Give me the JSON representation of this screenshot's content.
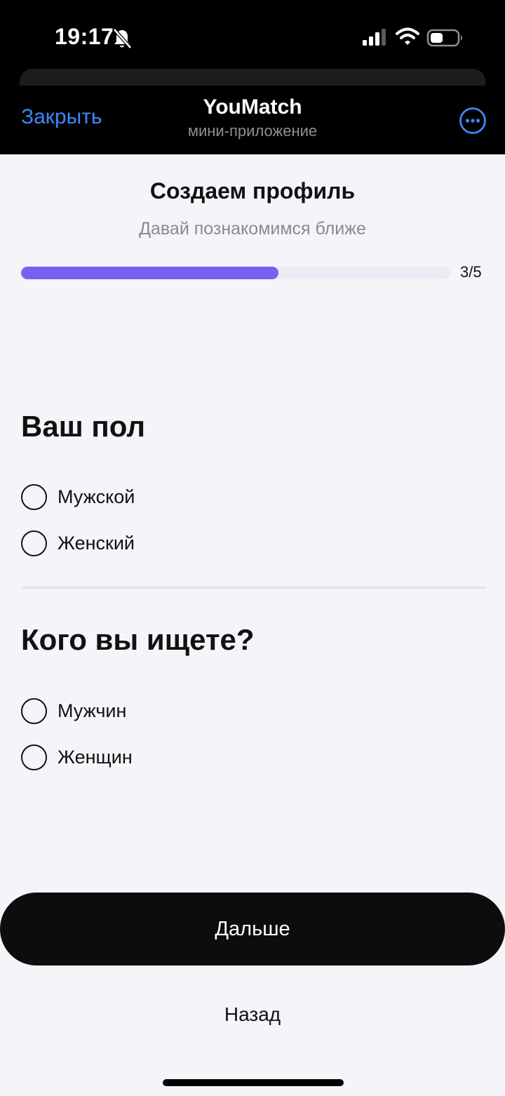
{
  "status_bar": {
    "time": "19:17",
    "icons": [
      "bell-slash-icon",
      "cellular-signal-icon",
      "wifi-icon",
      "battery-icon"
    ]
  },
  "header": {
    "close_label": "Закрыть",
    "title": "YouMatch",
    "subtitle": "мини-приложение",
    "more_icon": "more-circle-icon"
  },
  "profile": {
    "title": "Создаем профиль",
    "subtitle": "Давай познакомимся ближе",
    "progress_label": "3/5",
    "progress_fraction": 0.6
  },
  "gender_section": {
    "title": "Ваш пол",
    "options": [
      {
        "label": "Мужской",
        "selected": false
      },
      {
        "label": "Женский",
        "selected": false
      }
    ]
  },
  "seeking_section": {
    "title": "Кого вы ищете?",
    "options": [
      {
        "label": "Мужчин",
        "selected": false
      },
      {
        "label": "Женщин",
        "selected": false
      }
    ]
  },
  "actions": {
    "next_label": "Дальше",
    "back_label": "Назад"
  },
  "colors": {
    "accent": "#7b5ff1",
    "link": "#3e88f7",
    "background": "#f5f4f8"
  }
}
